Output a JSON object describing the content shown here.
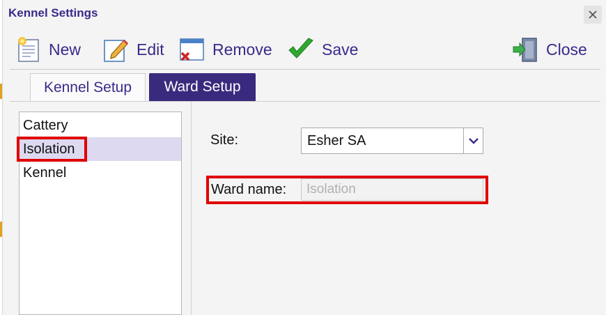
{
  "window": {
    "title": "Kennel Settings"
  },
  "toolbar": {
    "new_label": "New",
    "edit_label": "Edit",
    "remove_label": "Remove",
    "save_label": "Save",
    "close_label": "Close"
  },
  "tabs": [
    {
      "label": "Kennel Setup",
      "active": false
    },
    {
      "label": "Ward Setup",
      "active": true
    }
  ],
  "ward_list": {
    "items": [
      {
        "label": "Cattery",
        "selected": false
      },
      {
        "label": "Isolation",
        "selected": true
      },
      {
        "label": "Kennel",
        "selected": false
      }
    ]
  },
  "form": {
    "site_label": "Site:",
    "site_value": "Esher SA",
    "ward_name_label": "Ward name:",
    "ward_name_value": "Isolation"
  },
  "colors": {
    "accent": "#3a2a8a",
    "tab_active_bg": "#3a2a7e",
    "selection_bg": "#ddd9f0",
    "highlight_red": "#e00000",
    "save_green": "#2fa82f"
  },
  "icons": {
    "new": "new-document-icon",
    "edit": "edit-pencil-icon",
    "remove": "remove-x-icon",
    "save": "checkmark-icon",
    "close": "exit-door-icon",
    "window_close": "close-icon",
    "dropdown": "chevron-down-icon"
  }
}
